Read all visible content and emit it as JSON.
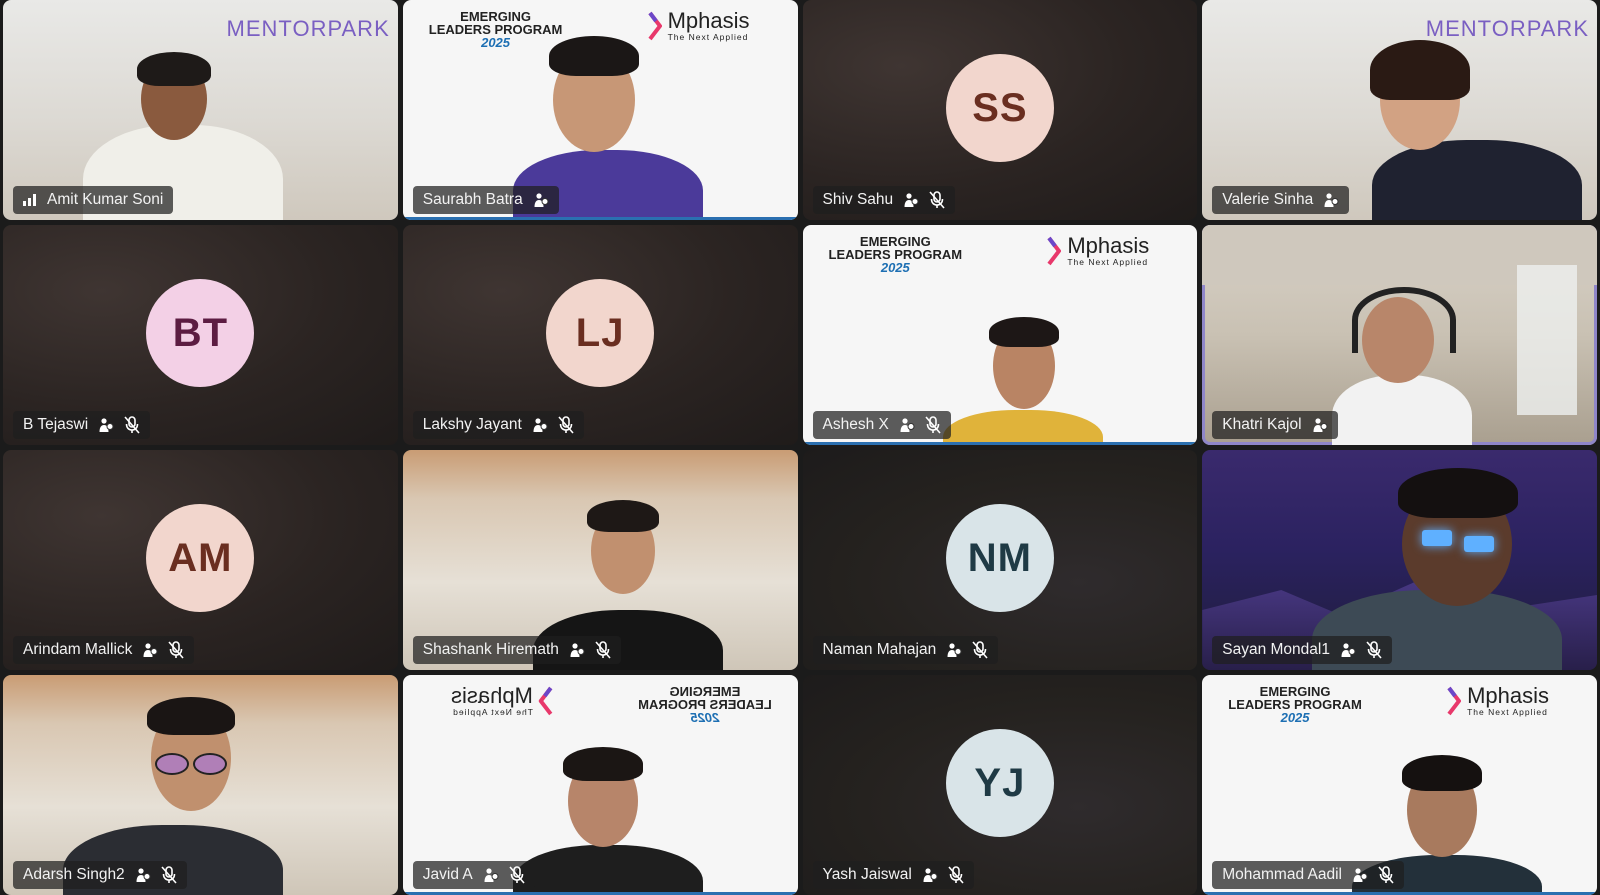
{
  "participants": [
    {
      "name": "Amit Kumar Soni",
      "kind": "video",
      "background": "mentorpark",
      "status": [
        "signal-icon"
      ]
    },
    {
      "name": "Saurabh Batra",
      "kind": "video",
      "background": "mphasis"
    },
    {
      "name": "Shiv Sahu",
      "kind": "avatar",
      "initials": "SS",
      "avatar_bg": "#f2d6cd",
      "avatar_fg": "#6a2e20",
      "muted": true
    },
    {
      "name": "Valerie Sinha",
      "kind": "video",
      "background": "mentorpark"
    },
    {
      "name": "B Tejaswi",
      "kind": "avatar",
      "initials": "BT",
      "avatar_bg": "#f3d0e6",
      "avatar_fg": "#5c1c42",
      "muted": true
    },
    {
      "name": "Lakshy Jayant",
      "kind": "avatar",
      "initials": "LJ",
      "avatar_bg": "#f2d6cd",
      "avatar_fg": "#6a2e20",
      "muted": true
    },
    {
      "name": "Ashesh X",
      "kind": "video",
      "background": "mphasis",
      "muted": true
    },
    {
      "name": "Khatri Kajol",
      "kind": "video",
      "background": "room",
      "active_speaker": true
    },
    {
      "name": "Arindam Mallick",
      "kind": "avatar",
      "initials": "AM",
      "avatar_bg": "#f2d6cd",
      "avatar_fg": "#6a2e20",
      "muted": true
    },
    {
      "name": "Shashank Hiremath",
      "kind": "video",
      "background": "wood",
      "muted": true
    },
    {
      "name": "Naman Mahajan",
      "kind": "avatar",
      "initials": "NM",
      "avatar_bg": "#d9e4e8",
      "avatar_fg": "#1f3a45",
      "muted": true
    },
    {
      "name": "Sayan Mondal1",
      "kind": "video",
      "background": "night",
      "muted": true
    },
    {
      "name": "Adarsh Singh2",
      "kind": "video",
      "background": "wood",
      "muted": true
    },
    {
      "name": "Javid A",
      "kind": "video",
      "background": "mphasis-mirrored",
      "muted": true
    },
    {
      "name": "Yash Jaiswal",
      "kind": "avatar",
      "initials": "YJ",
      "avatar_bg": "#d9e4e8",
      "avatar_fg": "#1f3a45",
      "muted": true
    },
    {
      "name": "Mohammad Aadil",
      "kind": "video",
      "background": "mphasis",
      "muted": true
    }
  ],
  "branding": {
    "mentorpark": "MENTORPARK",
    "elp_line1": "EMERGING",
    "elp_line2": "LEADERS PROGRAM",
    "elp_year": "2025",
    "mphasis": "Mphasis",
    "mphasis_tag": "The Next Applied"
  },
  "colors": {
    "active_border": "#8f86c9",
    "nametag_bg": "rgba(30,30,30,0.72)",
    "brand_purple": "#7a5fc2",
    "accent_blue": "#2a6fb0"
  },
  "icons": {
    "badge": "raised-hand-icon",
    "muted": "mic-off-icon",
    "signal": "signal-icon"
  }
}
